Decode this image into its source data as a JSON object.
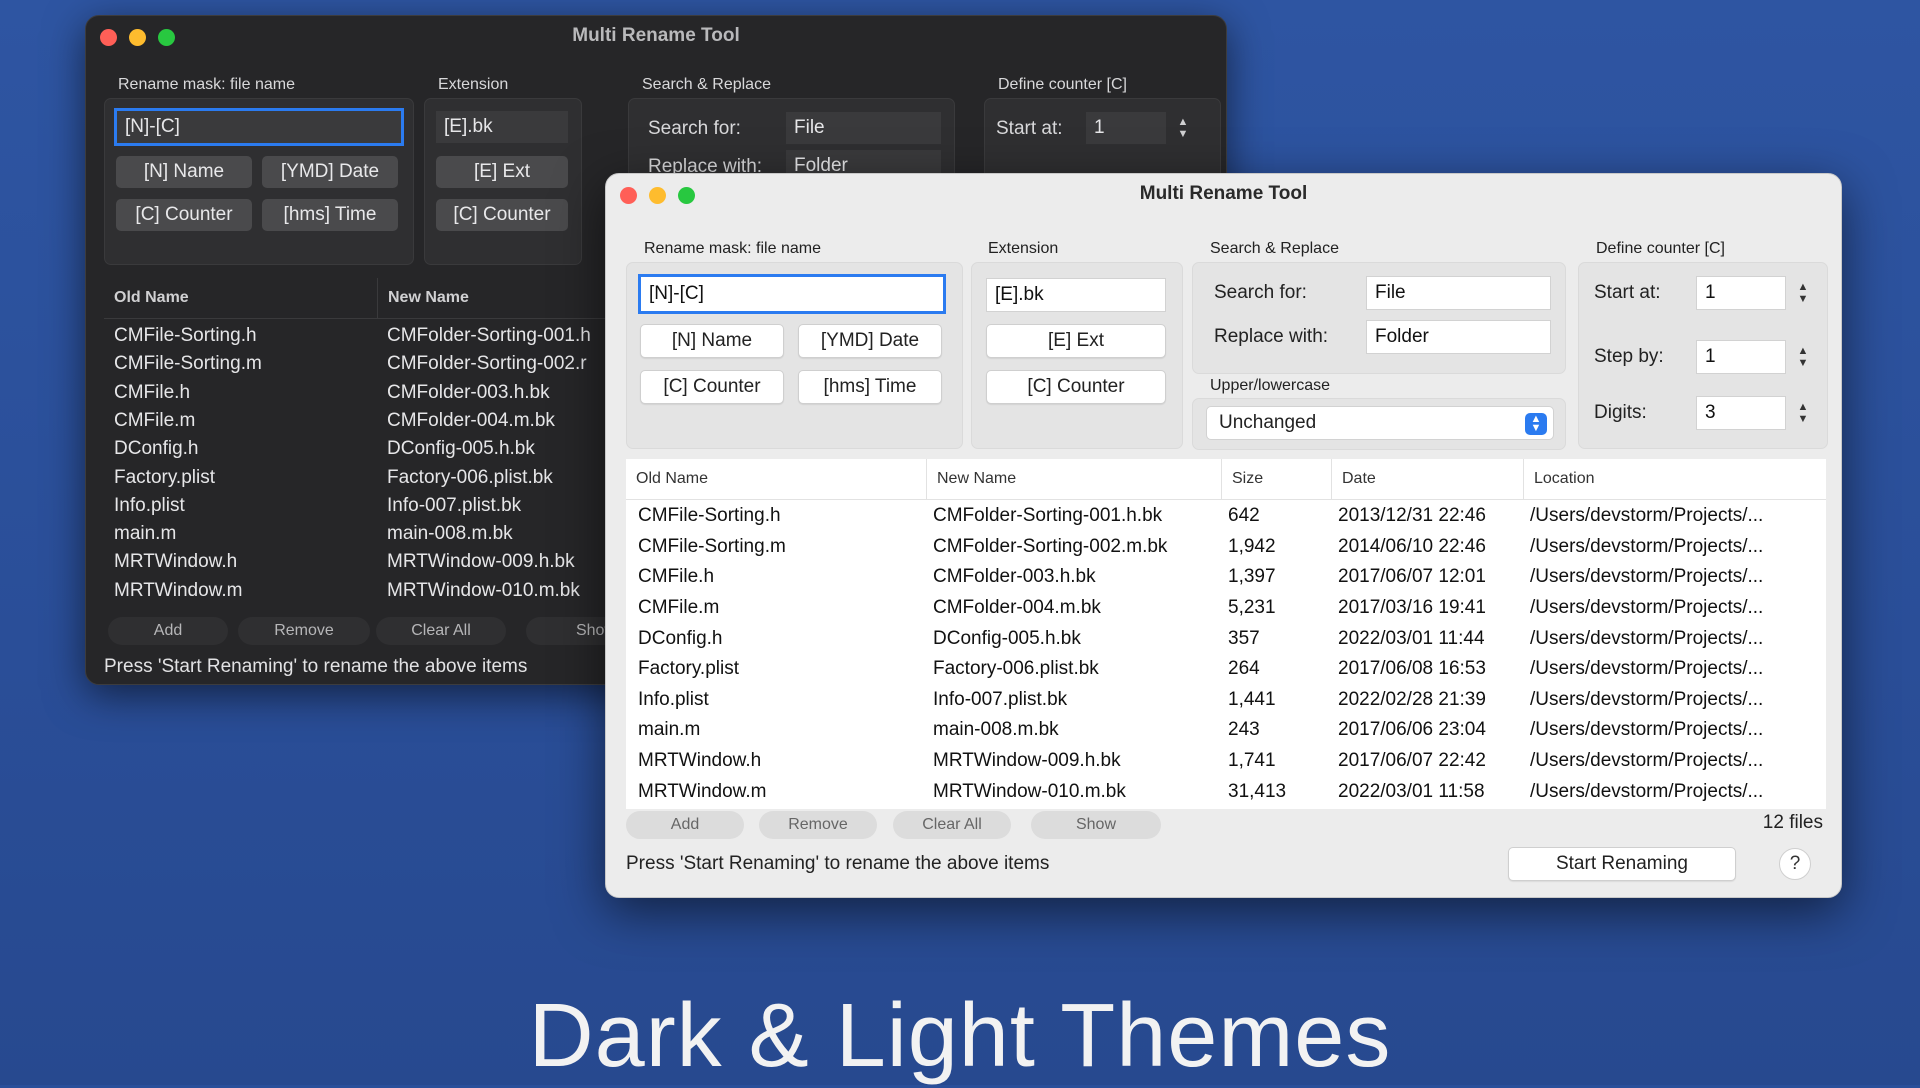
{
  "caption": "Dark & Light Themes",
  "dark_window": {
    "title": "Multi Rename Tool",
    "rename_mask_label": "Rename mask: file name",
    "mask_value": "[N]-[C]",
    "buttons": {
      "name": "[N] Name",
      "date": "[YMD] Date",
      "counter": "[C] Counter",
      "time": "[hms] Time"
    },
    "extension_label": "Extension",
    "extension_value": "[E].bk",
    "ext_button": "[E] Ext",
    "ext_counter_button": "[C] Counter",
    "search_replace_label": "Search & Replace",
    "search_for_label": "Search for:",
    "search_for_value": "File",
    "replace_with_label": "Replace with:",
    "replace_with_value": "Folder",
    "counter_label": "Define counter [C]",
    "start_at_label": "Start at:",
    "start_at_value": "1",
    "columns": [
      "Old Name",
      "New Name"
    ],
    "rows": [
      [
        "CMFile-Sorting.h",
        "CMFolder-Sorting-001.h"
      ],
      [
        "CMFile-Sorting.m",
        "CMFolder-Sorting-002.r"
      ],
      [
        "CMFile.h",
        "CMFolder-003.h.bk"
      ],
      [
        "CMFile.m",
        "CMFolder-004.m.bk"
      ],
      [
        "DConfig.h",
        "DConfig-005.h.bk"
      ],
      [
        "Factory.plist",
        "Factory-006.plist.bk"
      ],
      [
        "Info.plist",
        "Info-007.plist.bk"
      ],
      [
        "main.m",
        "main-008.m.bk"
      ],
      [
        "MRTWindow.h",
        "MRTWindow-009.h.bk"
      ],
      [
        "MRTWindow.m",
        "MRTWindow-010.m.bk"
      ]
    ],
    "footer": {
      "add": "Add",
      "remove": "Remove",
      "clear_all": "Clear All",
      "show": "Show"
    },
    "status": "Press 'Start Renaming' to rename the above items"
  },
  "light_window": {
    "title": "Multi Rename Tool",
    "rename_mask_label": "Rename mask: file name",
    "mask_value": "[N]-[C]",
    "buttons": {
      "name": "[N] Name",
      "date": "[YMD] Date",
      "counter": "[C] Counter",
      "time": "[hms] Time"
    },
    "extension_label": "Extension",
    "extension_value": "[E].bk",
    "ext_button": "[E] Ext",
    "ext_counter_button": "[C] Counter",
    "search_replace_label": "Search & Replace",
    "search_for_label": "Search for:",
    "search_for_value": "File",
    "replace_with_label": "Replace with:",
    "replace_with_value": "Folder",
    "case_label": "Upper/lowercase",
    "case_value": "Unchanged",
    "counter_label": "Define counter [C]",
    "start_at_label": "Start at:",
    "start_at_value": "1",
    "step_by_label": "Step by:",
    "step_by_value": "1",
    "digits_label": "Digits:",
    "digits_value": "3",
    "columns": [
      "Old Name",
      "New Name",
      "Size",
      "Date",
      "Location"
    ],
    "rows": [
      [
        "CMFile-Sorting.h",
        "CMFolder-Sorting-001.h.bk",
        "642",
        "2013/12/31 22:46",
        "/Users/devstorm/Projects/..."
      ],
      [
        "CMFile-Sorting.m",
        "CMFolder-Sorting-002.m.bk",
        "1,942",
        "2014/06/10 22:46",
        "/Users/devstorm/Projects/..."
      ],
      [
        "CMFile.h",
        "CMFolder-003.h.bk",
        "1,397",
        "2017/06/07 12:01",
        "/Users/devstorm/Projects/..."
      ],
      [
        "CMFile.m",
        "CMFolder-004.m.bk",
        "5,231",
        "2017/03/16 19:41",
        "/Users/devstorm/Projects/..."
      ],
      [
        "DConfig.h",
        "DConfig-005.h.bk",
        "357",
        "2022/03/01 11:44",
        "/Users/devstorm/Projects/..."
      ],
      [
        "Factory.plist",
        "Factory-006.plist.bk",
        "264",
        "2017/06/08 16:53",
        "/Users/devstorm/Projects/..."
      ],
      [
        "Info.plist",
        "Info-007.plist.bk",
        "1,441",
        "2022/02/28 21:39",
        "/Users/devstorm/Projects/..."
      ],
      [
        "main.m",
        "main-008.m.bk",
        "243",
        "2017/06/06 23:04",
        "/Users/devstorm/Projects/..."
      ],
      [
        "MRTWindow.h",
        "MRTWindow-009.h.bk",
        "1,741",
        "2017/06/07 22:42",
        "/Users/devstorm/Projects/..."
      ],
      [
        "MRTWindow.m",
        "MRTWindow-010.m.bk",
        "31,413",
        "2022/03/01 11:58",
        "/Users/devstorm/Projects/..."
      ]
    ],
    "footer": {
      "add": "Add",
      "remove": "Remove",
      "clear_all": "Clear All",
      "show": "Show"
    },
    "file_count": "12 files",
    "status": "Press 'Start Renaming' to rename the above items",
    "start_button": "Start Renaming",
    "help": "?"
  }
}
